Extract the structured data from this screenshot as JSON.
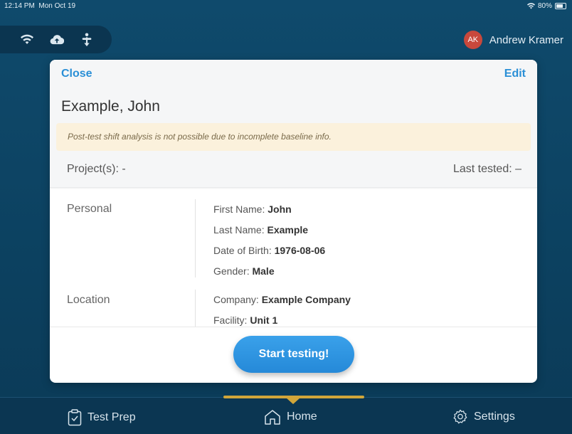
{
  "status_bar": {
    "time": "12:14 PM",
    "date": "Mon Oct 19",
    "battery": "80%"
  },
  "toolbar": {
    "icons": [
      "wifi-icon",
      "cloud-upload-icon",
      "sync-icon"
    ],
    "user": {
      "initials": "AK",
      "name": "Andrew Kramer",
      "avatar_color": "#c8483c"
    }
  },
  "modal": {
    "close_label": "Close",
    "edit_label": "Edit",
    "patient_name": "Example, John",
    "warning": "Post-test shift analysis is not possible due to incomplete baseline info.",
    "projects": "Project(s): -",
    "last_tested": "Last tested: –",
    "sections": {
      "personal": {
        "title": "Personal",
        "fields": [
          {
            "label": "First Name:",
            "value": "John"
          },
          {
            "label": "Last Name:",
            "value": "Example"
          },
          {
            "label": "Date of Birth:",
            "value": "1976-08-06"
          },
          {
            "label": "Gender:",
            "value": "Male"
          }
        ]
      },
      "location": {
        "title": "Location",
        "fields": [
          {
            "label": "Company:",
            "value": "Example Company"
          },
          {
            "label": "Facility:",
            "value": "Unit 1"
          }
        ]
      }
    },
    "start_button": "Start testing!"
  },
  "tabbar": {
    "tabs": [
      {
        "label": "Test Prep",
        "icon": "clipboard-icon"
      },
      {
        "label": "Home",
        "icon": "home-icon",
        "active": true
      },
      {
        "label": "Settings",
        "icon": "gear-icon"
      }
    ],
    "accent": "#d1a63a"
  }
}
